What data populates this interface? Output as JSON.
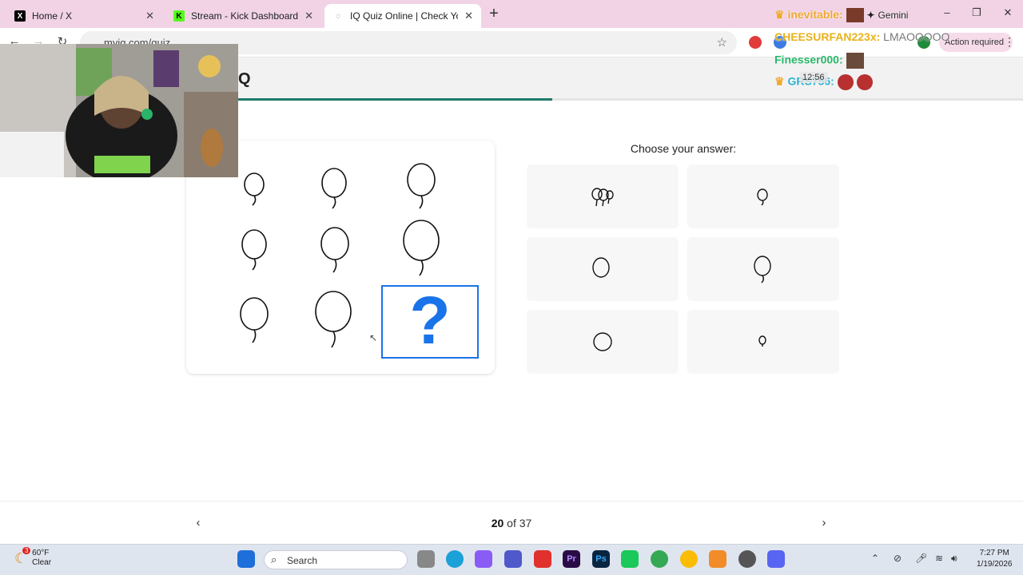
{
  "browser": {
    "tabs": [
      {
        "title": "Home / X",
        "icon": "x-logo-icon"
      },
      {
        "title": "Stream - Kick Dashboard",
        "icon": "kick-logo-icon"
      },
      {
        "title": "IQ Quiz Online | Check Your IQ",
        "icon": "globe-icon",
        "active": true
      }
    ],
    "url": "myiq.com/quiz",
    "action_required": "Action required"
  },
  "page": {
    "site_title": "Q",
    "progress_fraction": 0.4,
    "choose_label": "Choose your answer:",
    "question_mark": "?",
    "page_current": "20",
    "page_sep": "of",
    "page_total": "37"
  },
  "stream_overlay": {
    "chat": [
      {
        "user": "inevitable:",
        "message": "Gemini",
        "color": "#f0a830"
      },
      {
        "user": "CHEESURFAN223x:",
        "message": "LMAOOOOO",
        "color": "#e7b21c"
      },
      {
        "user": "Finesser000:",
        "message": "",
        "color": "#28b86a"
      },
      {
        "user": "GRS756:",
        "message": "",
        "color": "#2ab0d0"
      }
    ],
    "timer": "12:56"
  },
  "taskbar": {
    "weather_temp": "60°F",
    "weather_desc": "Clear",
    "weather_badge": "3",
    "search_placeholder": "Search",
    "time": "7:27 PM",
    "date": "1/19/2026"
  },
  "accent_color": "#1a73e8",
  "progress_color": "#1f7a6c"
}
